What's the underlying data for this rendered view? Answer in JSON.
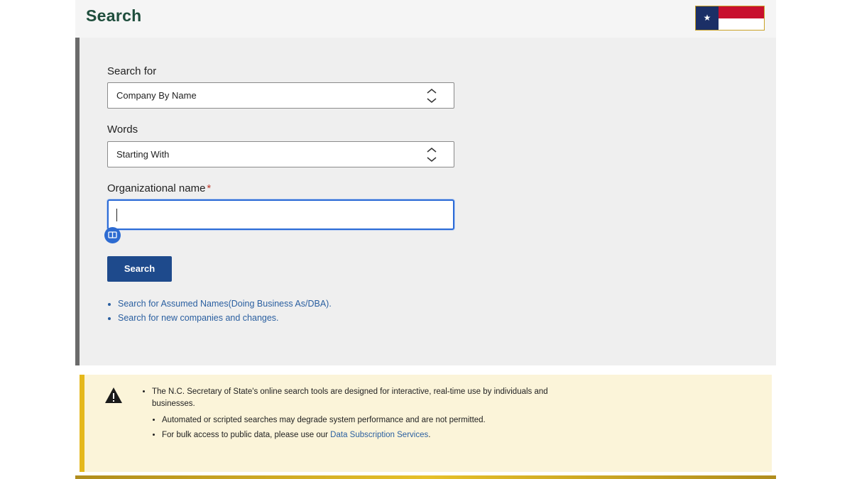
{
  "header": {
    "title": "Search"
  },
  "form": {
    "search_for": {
      "label": "Search for",
      "value": "Company By Name"
    },
    "words": {
      "label": "Words",
      "value": "Starting With"
    },
    "org_name": {
      "label": "Organizational name",
      "required_mark": "*",
      "value": ""
    },
    "search_button": "Search"
  },
  "links": [
    "Search for Assumed Names(Doing Business As/DBA).",
    "Search for new companies and changes."
  ],
  "notice": {
    "main_text": "The N.C. Secretary of State's online search tools are designed for interactive, real-time use by individuals and businesses.",
    "sub_1": "Automated or scripted searches may degrade system performance and are not permitted.",
    "sub_2_prefix": "For bulk access to public data, please use our ",
    "sub_2_link": "Data Subscription Services",
    "sub_2_suffix": "."
  },
  "colors": {
    "accent": "#1e4a8c",
    "title": "#1f4e3d",
    "notice_bg": "#fbf4d9",
    "notice_border": "#e5b81b"
  }
}
